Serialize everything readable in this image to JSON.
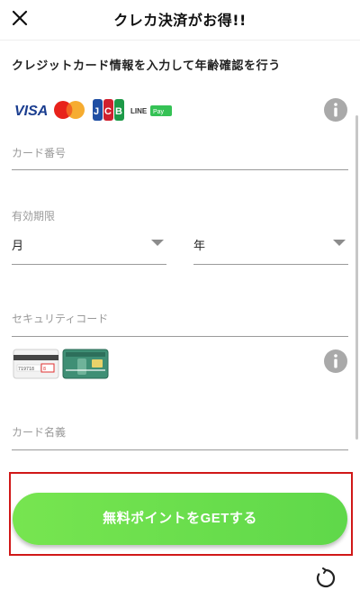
{
  "header": {
    "title": "クレカ決済がお得!!",
    "close_icon": "close-icon"
  },
  "form": {
    "subtitle": "クレジットカード情報を入力して年齢確認を行う",
    "brands": [
      "VISA",
      "Mastercard",
      "JCB",
      "LINE Pay"
    ],
    "card_number": {
      "placeholder": "カード番号",
      "value": ""
    },
    "expiry": {
      "label": "有効期限",
      "month_value": "月",
      "year_value": "年"
    },
    "security_code": {
      "placeholder": "セキュリティコード",
      "value": "",
      "sample_numbers": [
        "719718",
        "8 "
      ]
    },
    "card_name": {
      "placeholder": "カード名義",
      "value": ""
    }
  },
  "cta": {
    "label": "無料ポイントをGETする",
    "color": "#6be04d",
    "highlight_color": "#d01818"
  },
  "icons": {
    "info": "info-icon",
    "spinner": "loading-spinner-icon"
  }
}
